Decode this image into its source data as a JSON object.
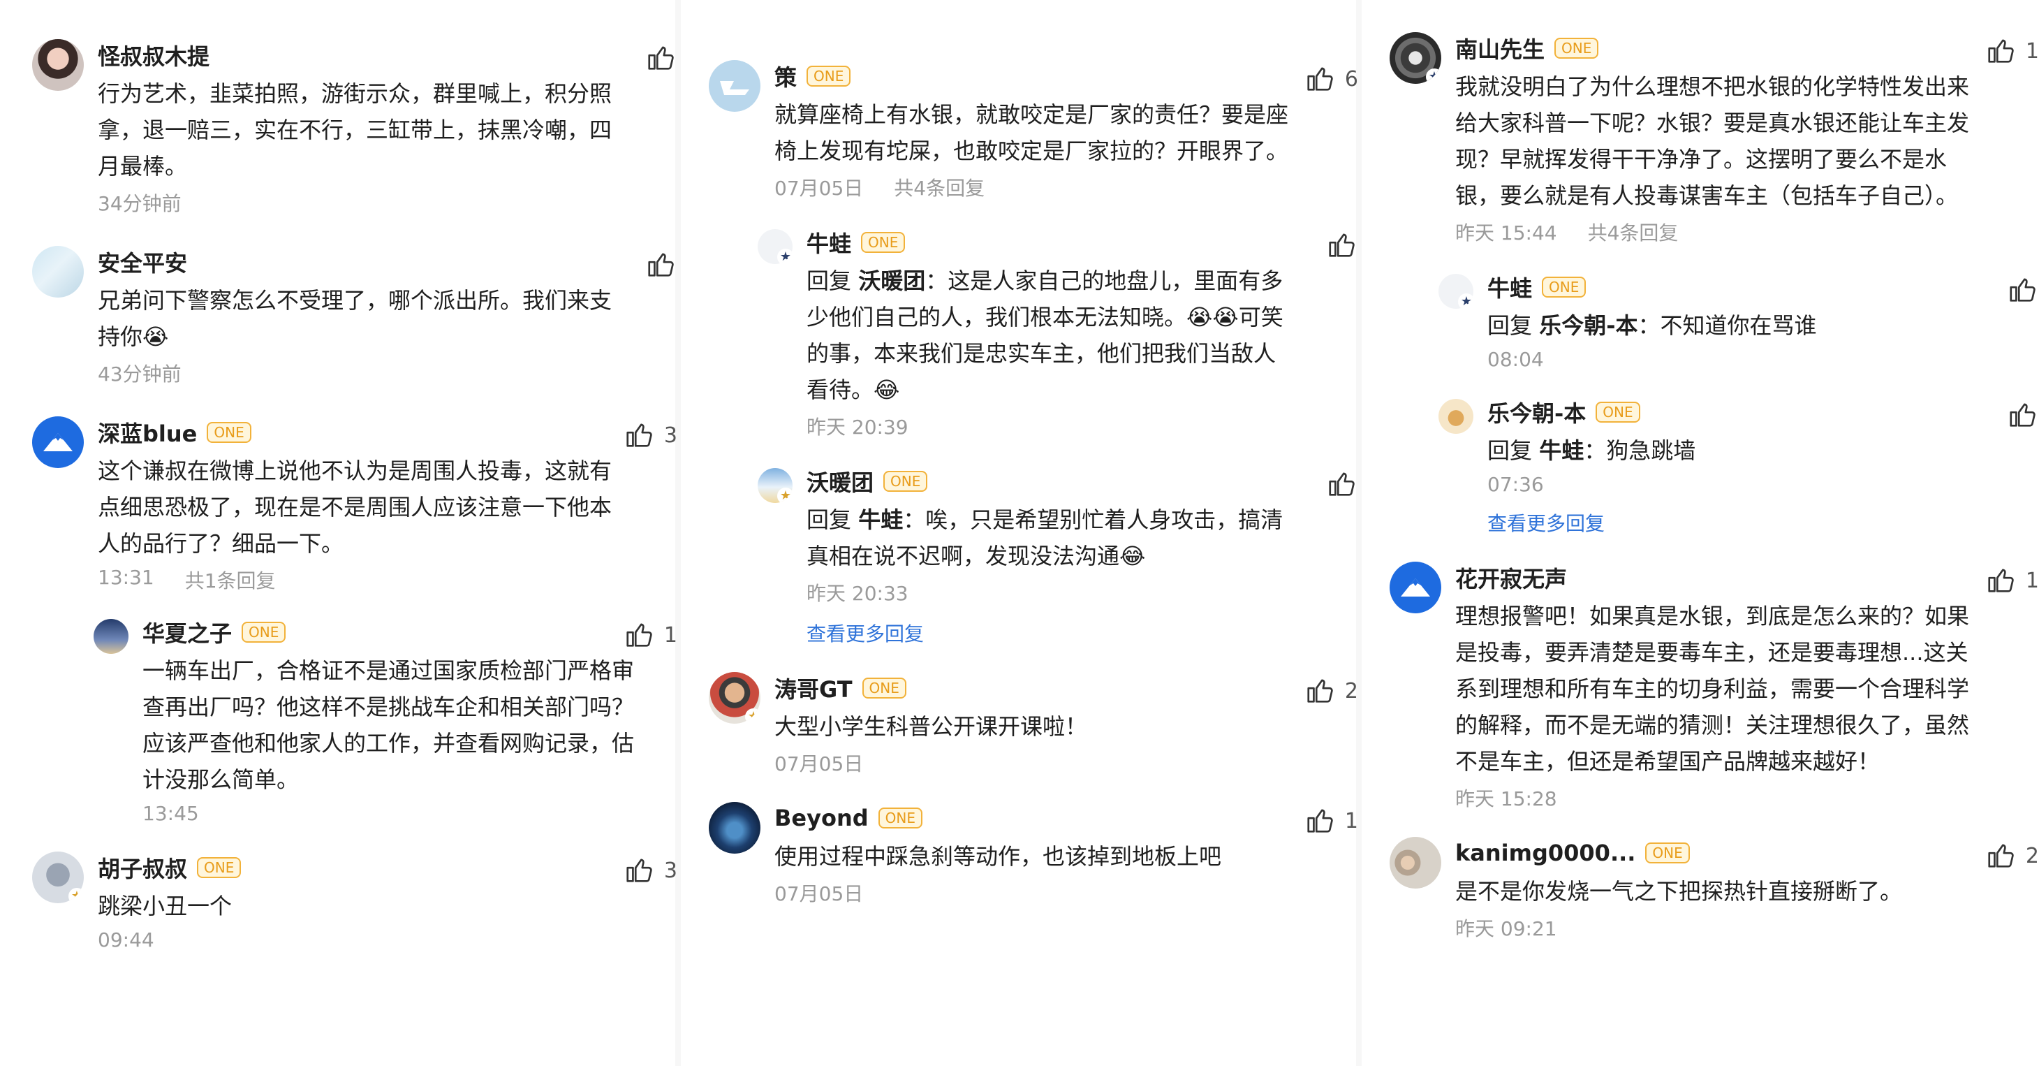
{
  "colors": {
    "accent_link": "#2f73d9",
    "tag_orange": "#e89c1a",
    "meta_gray": "#9a9a9a"
  },
  "icons": {
    "like": "thumbs-up-icon",
    "badge": "star-badge-icon"
  },
  "columns": [
    {
      "comments": [
        {
          "name": "怪叔叔木提",
          "tag": "",
          "likes": "",
          "text": "行为艺术，韭菜拍照，游街示众，群里喊上，积分照拿，退一赔三，实在不行，三缸带上，抹黑冷嘲，四月最棒。",
          "time": "34分钟前",
          "replies_count": ""
        },
        {
          "name": "安全平安",
          "tag": "",
          "likes": "",
          "text": "兄弟问下警察怎么不受理了，哪个派出所。我们来支持你😭",
          "time": "43分钟前",
          "replies_count": ""
        },
        {
          "name": "深蓝blue",
          "tag": "ONE",
          "likes": "3",
          "text": "这个谦叔在微博上说他不认为是周围人投毒，这就有点细思恐极了，现在是不是周围人应该注意一下他本人的品行了？细品一下。",
          "time": "13:31",
          "replies_count": "共1条回复"
        },
        {
          "name": "华夏之子",
          "tag": "ONE",
          "likes": "1",
          "text": "一辆车出厂，合格证不是通过国家质检部门严格审查再出厂吗？他这样不是挑战车企和相关部门吗？应该严查他和他家人的工作，并查看网购记录，估计没那么简单。",
          "time": "13:45",
          "replies_count": ""
        },
        {
          "name": "胡子叔叔",
          "tag": "ONE",
          "likes": "3",
          "text": "跳梁小丑一个",
          "time": "09:44",
          "replies_count": ""
        }
      ]
    },
    {
      "comments": [
        {
          "name": "策",
          "tag": "ONE",
          "likes": "6",
          "text": "就算座椅上有水银，就敢咬定是厂家的责任？要是座椅上发现有坨屎，也敢咬定是厂家拉的？开眼界了。",
          "time": "07月05日",
          "replies_count": "共4条回复"
        },
        {
          "name": "牛蛙",
          "tag": "ONE",
          "likes": "",
          "reply_prefix": "回复",
          "reply_to": "沃暖团",
          "text": "：这是人家自己的地盘儿，里面有多少他们自己的人，我们根本无法知晓。😭😭可笑的事，本来我们是忠实车主，他们把我们当敌人看待。😂",
          "time": "昨天 20:39"
        },
        {
          "name": "沃暖团",
          "tag": "ONE",
          "likes": "",
          "reply_prefix": "回复",
          "reply_to": "牛蛙",
          "text": "：唉，只是希望别忙着人身攻击，搞清真相在说不迟啊，发现没法沟通😂",
          "time": "昨天 20:33",
          "more": "查看更多回复"
        },
        {
          "name": "涛哥GT",
          "tag": "ONE",
          "likes": "2",
          "text": "大型小学生科普公开课开课啦！",
          "time": "07月05日",
          "replies_count": ""
        },
        {
          "name": "Beyond",
          "tag": "ONE",
          "likes": "1",
          "text": "使用过程中踩急刹等动作，也该掉到地板上吧",
          "time": "07月05日",
          "replies_count": ""
        }
      ]
    },
    {
      "comments": [
        {
          "name": "南山先生",
          "tag": "ONE",
          "likes": "1",
          "text": "我就没明白了为什么理想不把水银的化学特性发出来给大家科普一下呢？水银？要是真水银还能让车主发现？早就挥发得干干净净了。这摆明了要么不是水银，要么就是有人投毒谋害车主（包括车子自己）。",
          "time": "昨天 15:44",
          "replies_count": "共4条回复"
        },
        {
          "name": "牛蛙",
          "tag": "ONE",
          "likes": "",
          "reply_prefix": "回复",
          "reply_to": "乐今朝-本",
          "text": "：不知道你在骂谁",
          "time": "08:04"
        },
        {
          "name": "乐今朝-本",
          "tag": "ONE",
          "likes": "",
          "reply_prefix": "回复",
          "reply_to": "牛蛙",
          "text": "：狗急跳墙",
          "time": "07:36",
          "more": "查看更多回复"
        },
        {
          "name": "花开寂无声",
          "tag": "",
          "likes": "1",
          "text": "理想报警吧！如果真是水银，到底是怎么来的？如果是投毒，要弄清楚是要毒车主，还是要毒理想...这关系到理想和所有车主的切身利益，需要一个合理科学的解释，而不是无端的猜测！关注理想很久了，虽然不是车主，但还是希望国产品牌越来越好！",
          "time": "昨天 15:28",
          "replies_count": ""
        },
        {
          "name": "kanimg0000...",
          "tag": "ONE",
          "likes": "2",
          "text": "是不是你发烧一气之下把探热针直接掰断了。",
          "time": "昨天 09:21",
          "replies_count": ""
        }
      ]
    }
  ]
}
